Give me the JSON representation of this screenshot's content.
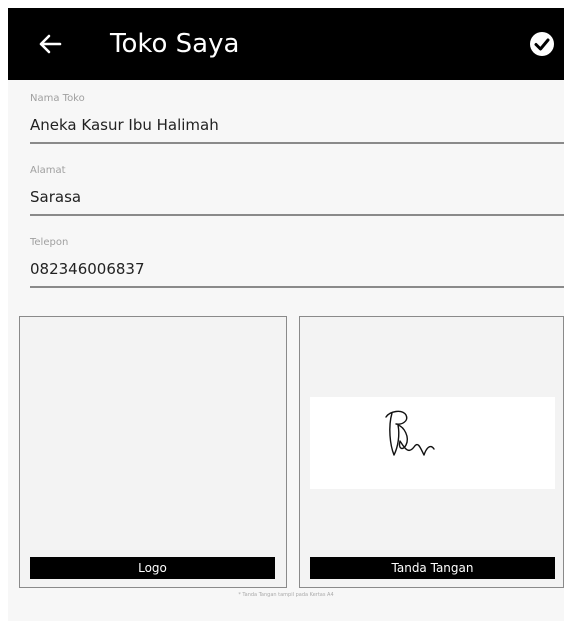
{
  "appbar": {
    "title": "Toko Saya",
    "back_icon": "arrow-left-icon",
    "confirm_icon": "check-circle-icon"
  },
  "form": {
    "fields": [
      {
        "label": "Nama Toko",
        "value": "Aneka Kasur Ibu Halimah"
      },
      {
        "label": "Alamat",
        "value": "Sarasa"
      },
      {
        "label": "Telepon",
        "value": "082346006837"
      }
    ]
  },
  "images": {
    "logo_caption": "Logo",
    "signature_caption": "Tanda Tangan"
  },
  "footer": {
    "note": "* Tanda Tangan tampil pada Kertas A4"
  },
  "colors": {
    "appbar_bg": "#000000",
    "appbar_text": "#ffffff",
    "underline": "#8a8a8a"
  }
}
